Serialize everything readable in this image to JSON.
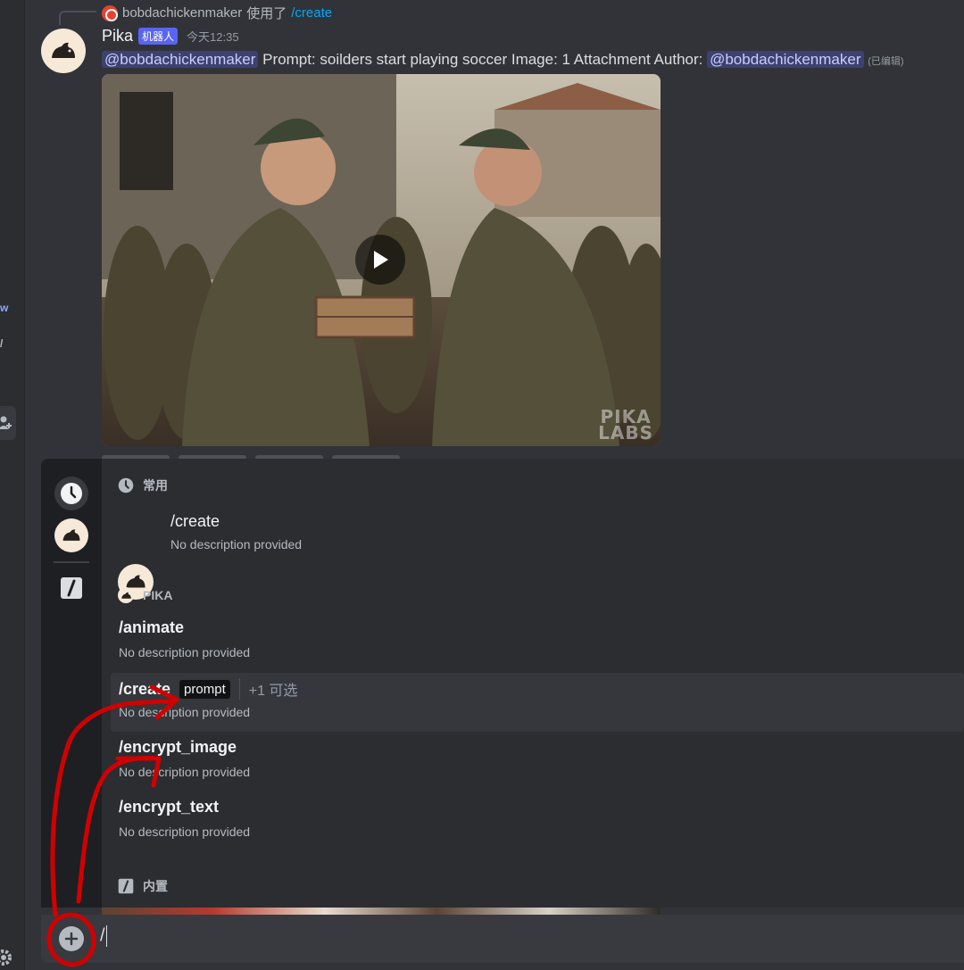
{
  "left_rail": {
    "fragment_1": "w",
    "fragment_2": "/"
  },
  "reply": {
    "username": "bobdachickenmaker",
    "used_text": "使用了",
    "command": "/create"
  },
  "message": {
    "author": "Pika",
    "bot_tag": "机器人",
    "timestamp": "今天12:35",
    "mention": "@bobdachickenmaker",
    "body": " Prompt: soilders start playing soccer  Image: 1 Attachment  Author: ",
    "author_mention": "@bobdachickenmaker",
    "edited": "(已编辑)"
  },
  "video": {
    "watermark_line1": "PIKA",
    "watermark_line2": "LABS"
  },
  "autocomplete": {
    "frequent_section": {
      "title": "常用",
      "command": "/create",
      "description": "No description provided"
    },
    "pika_section": {
      "title": "PIKA",
      "commands": [
        {
          "name": "/animate",
          "description": "No description provided",
          "chip": "",
          "optional": ""
        },
        {
          "name": "/create",
          "description": "No description provided",
          "chip": "prompt",
          "optional": "+1 可选"
        },
        {
          "name": "/encrypt_image",
          "description": "No description provided",
          "chip": "",
          "optional": ""
        },
        {
          "name": "/encrypt_text",
          "description": "No description provided",
          "chip": "",
          "optional": ""
        }
      ]
    },
    "builtin_section": {
      "title": "内置"
    }
  },
  "composer": {
    "value": "/"
  },
  "colors": {
    "accent": "#5865f2",
    "annotation": "#d10000",
    "link": "#00a8fc"
  }
}
